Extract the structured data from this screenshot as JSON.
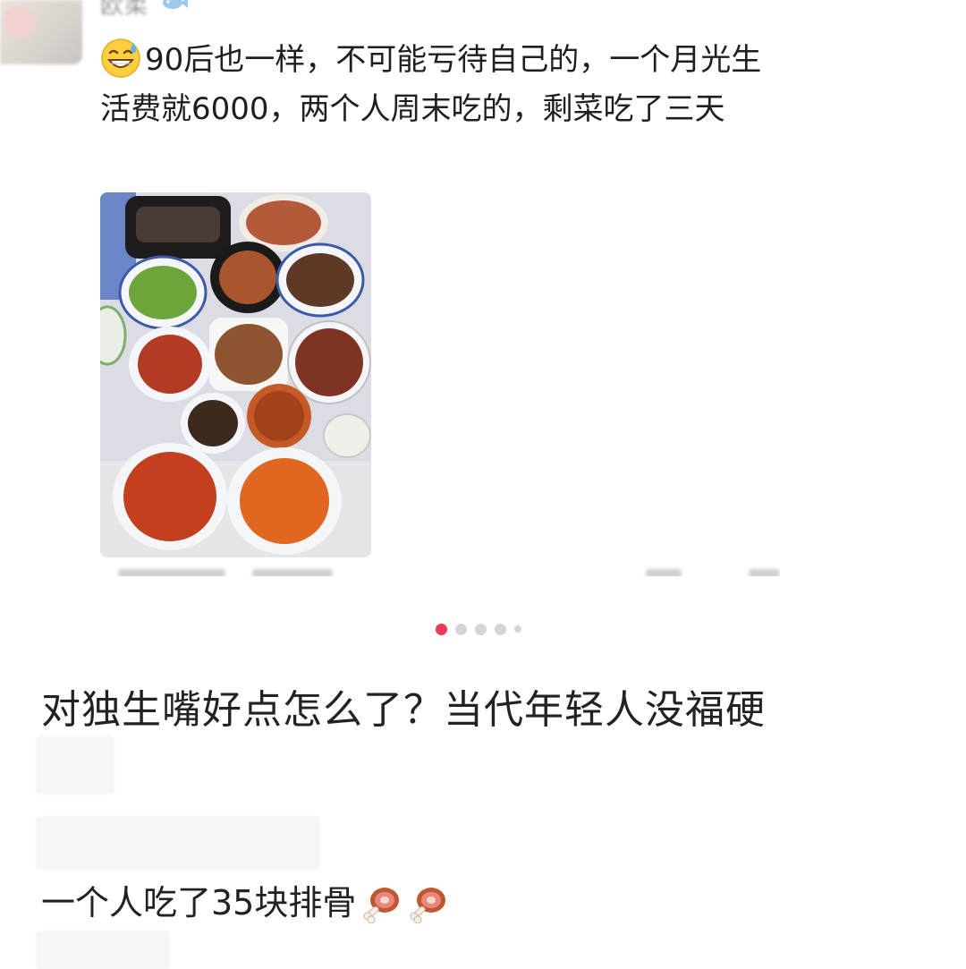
{
  "comment": {
    "username": "欧柔",
    "text": "90后也一样，不可能亏待自己的，一个月光生活费就6000，两个人周末吃的，剩菜吃了三天",
    "leading_icon": "sweat-smile-icon",
    "name_badge_icon": "fish-icon",
    "photo_icon": "food-dishes-photo"
  },
  "carousel": {
    "dots": [
      {
        "active": true
      },
      {
        "active": false
      },
      {
        "active": false
      },
      {
        "active": false
      },
      {
        "active": false,
        "small": true
      }
    ],
    "active_color": "#f03a52",
    "inactive_color": "#d5d5d5"
  },
  "post": {
    "title": "对独生嘴好点怎么了？当代年轻人没福硬"
  },
  "reply": {
    "text": "一个人吃了35块排骨",
    "trailing_icons": [
      "meat-on-bone-icon",
      "meat-on-bone-icon"
    ]
  }
}
